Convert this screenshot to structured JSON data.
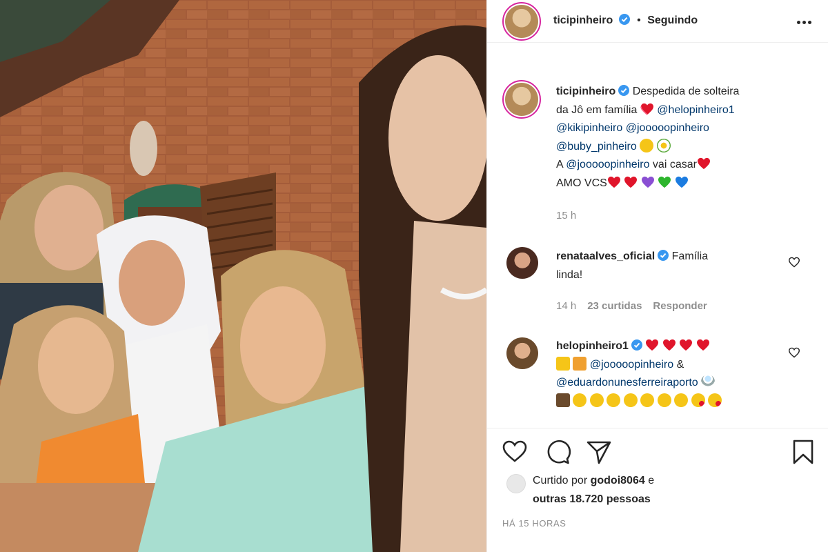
{
  "post": {
    "author": "ticipinheiro",
    "follow_status": "Seguindo",
    "separator": "•",
    "caption": {
      "line1": "Despedida de solteira",
      "line2": "da Jô em família",
      "mentions": [
        "@helopinheiro1",
        "@kikipinheiro",
        "@jooooopinheiro",
        "@buby_pinheiro"
      ],
      "line4_prefix": "A",
      "line4_mention": "@jooooopinheiro",
      "line4_suffix": "vai casar",
      "line5": "AMO VCS"
    },
    "caption_time": "15 h"
  },
  "comments": [
    {
      "author": "renataalves_oficial",
      "text_line1": "Família",
      "text_line2": "linda!",
      "time": "14 h",
      "likes": "23 curtidas",
      "reply": "Responder"
    },
    {
      "author": "helopinheiro1",
      "mention1": "@jooooopinheiro",
      "amp": "&",
      "mention2": "@eduardonunesferreiraporto"
    }
  ],
  "likes": {
    "prefix": "Curtido por",
    "user": "godoi8064",
    "conj": "e",
    "others": "outras 18.720 pessoas"
  },
  "timestamp": "HÁ 15 HORAS",
  "colors": {
    "verified": "#3897f0",
    "mention": "#00376b",
    "red_heart": "#e0152b",
    "purple_heart": "#8a4fd3",
    "green_heart": "#2db52d",
    "blue_heart": "#1c7ce0",
    "story_ring": "#d6249f"
  },
  "icons": [
    "more-icon",
    "verified-icon",
    "like-icon",
    "comment-icon",
    "share-icon",
    "save-icon"
  ]
}
